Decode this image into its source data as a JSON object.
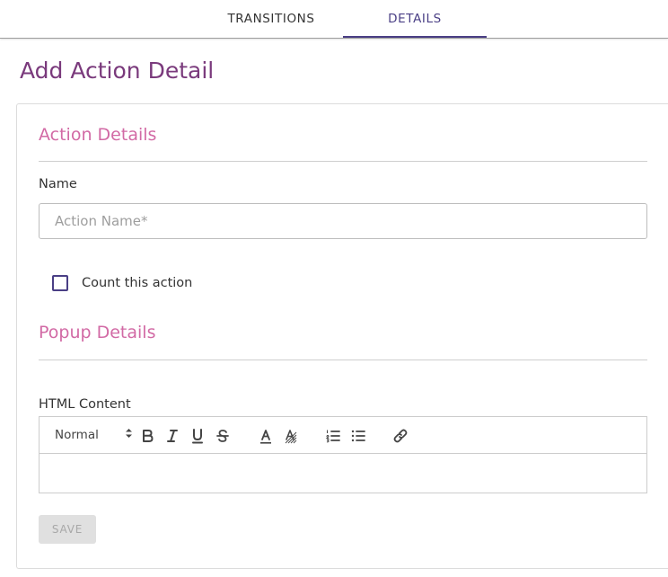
{
  "tabs": [
    {
      "label": "TRANSITIONS",
      "active": false
    },
    {
      "label": "DETAILS",
      "active": true
    }
  ],
  "page_title": "Add Action Detail",
  "action_details": {
    "title": "Action Details",
    "name_label": "Name",
    "name_value": "",
    "name_placeholder": "Action Name*",
    "count_label": "Count this action",
    "count_checked": false
  },
  "popup_details": {
    "title": "Popup Details",
    "html_label": "HTML Content",
    "editor": {
      "format_value": "Normal",
      "tools": [
        "bold-icon",
        "italic-icon",
        "underline-icon",
        "strikethrough-icon",
        "font-color-icon",
        "background-color-icon",
        "ordered-list-icon",
        "bullet-list-icon",
        "link-icon"
      ]
    }
  },
  "save_label": "SAVE",
  "colors": {
    "accent": "#4a3f85",
    "title": "#7a3a7c",
    "section_title": "#d26aa5"
  }
}
